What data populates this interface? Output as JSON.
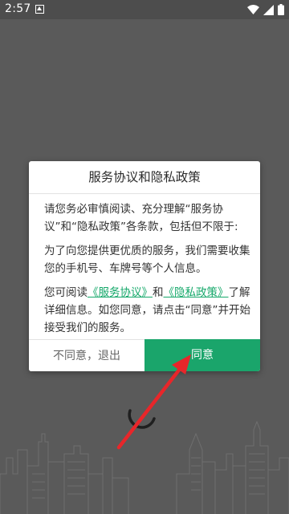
{
  "status_bar": {
    "time": "2:57"
  },
  "dialog": {
    "title": "服务协议和隐私政策",
    "para1": "请您务必审慎阅读、充分理解“服务协议”和“隐私政策”各条款，包括但不限于:",
    "para2": "为了向您提供更优质的服务，我们需要收集您的手机号、车牌号等个人信息。",
    "para3_prefix": "您可阅读",
    "service_link": "《服务协议》",
    "para3_and": "和",
    "privacy_link": "《隐私政策》",
    "para3_suffix": "了解详细信息。如您同意，请点击“同意”并开始接受我们的服务。",
    "decline_label": "不同意，退出",
    "agree_label": "同意"
  },
  "colors": {
    "accent": "#1aa56b",
    "link": "#15a86a",
    "annotation_arrow": "#e8262a",
    "background": "#5a5a5a"
  },
  "icons": {
    "notification": "notification-icon",
    "wifi": "wifi-icon",
    "signal": "signal-icon",
    "battery": "battery-icon",
    "loading": "loading-spinner-icon"
  }
}
